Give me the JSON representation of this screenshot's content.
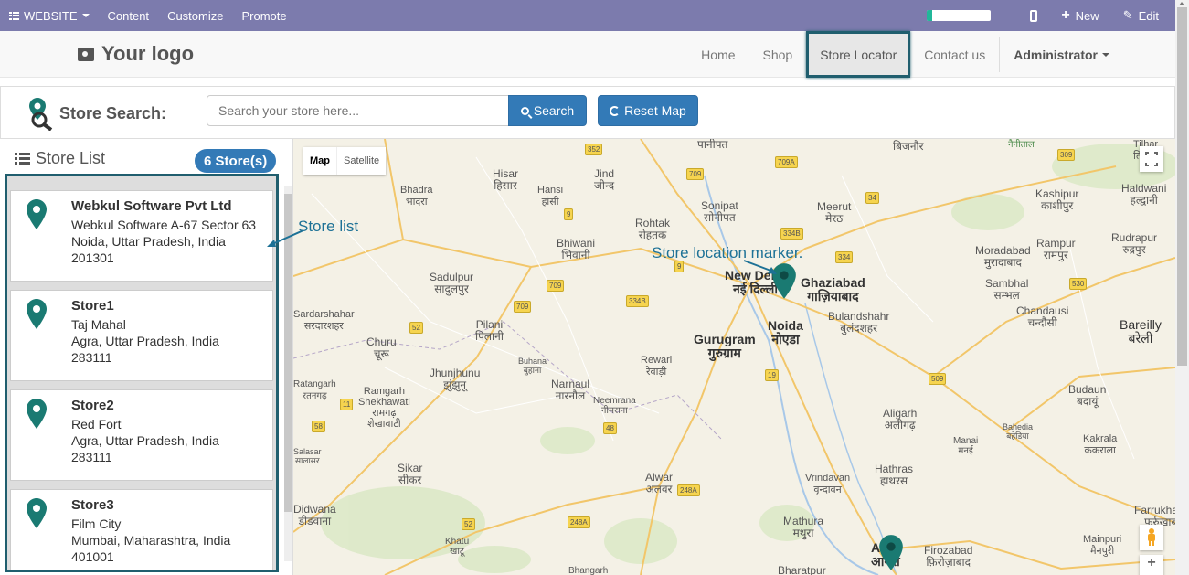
{
  "adminbar": {
    "website_label": "WEBSITE",
    "menu": [
      "Content",
      "Customize",
      "Promote"
    ],
    "progress_fraction": 0.08,
    "new_label": "New",
    "edit_label": "Edit"
  },
  "header": {
    "logo_text": "Your logo",
    "nav": [
      "Home",
      "Shop",
      "Store Locator",
      "Contact us"
    ],
    "active_nav": "Store Locator",
    "user_label": "Administrator"
  },
  "search": {
    "label": "Store Search:",
    "placeholder": "Search your store here...",
    "search_button": "Search",
    "reset_button": "Reset Map"
  },
  "store_list": {
    "title": "Store List",
    "count_badge": "6 Store(s)",
    "stores": [
      {
        "name": "Webkul Software Pvt Ltd",
        "line1": "Webkul Software A-67 Sector 63",
        "line2": "Noida, Uttar Pradesh, India",
        "line3": "201301"
      },
      {
        "name": "Store1",
        "line1": "Taj Mahal",
        "line2": "Agra, Uttar Pradesh, India",
        "line3": "283111"
      },
      {
        "name": "Store2",
        "line1": "Red Fort",
        "line2": "Agra, Uttar Pradesh, India",
        "line3": "283111"
      },
      {
        "name": "Store3",
        "line1": "Film City",
        "line2": "Mumbai, Maharashtra, India",
        "line3": "401001"
      }
    ]
  },
  "map": {
    "map_type": [
      "Map",
      "Satellite"
    ],
    "labels": [
      {
        "id": "panipat",
        "text": "पानीपत"
      },
      {
        "id": "bijnor",
        "text": "बिजनौर"
      },
      {
        "id": "hisar",
        "text": "Hisar\nहिसार"
      },
      {
        "id": "jind",
        "text": "Jind\nजीन्द"
      },
      {
        "id": "bhadra",
        "text": "Bhadra\nभादरा"
      },
      {
        "id": "hansi",
        "text": "Hansi\nहांसी"
      },
      {
        "id": "sonipat",
        "text": "Sonipat\nसोनीपत"
      },
      {
        "id": "meerut",
        "text": "Meerut\nमेरठ"
      },
      {
        "id": "kashipur",
        "text": "Kashipur\nकाशीपुर"
      },
      {
        "id": "haldwani",
        "text": "Haldwani\nहल्द्वानी"
      },
      {
        "id": "rohtak",
        "text": "Rohtak\nरोहतक"
      },
      {
        "id": "bhiwani",
        "text": "Bhiwani\nभिवानी"
      },
      {
        "id": "moradabad",
        "text": "Moradabad\nमुरादाबाद"
      },
      {
        "id": "rampur",
        "text": "Rampur\nरामपुर"
      },
      {
        "id": "rudrapur",
        "text": "Rudrapur\nरुद्रपुर"
      },
      {
        "id": "sadulpur",
        "text": "Sadulpur\nसादुलपुर"
      },
      {
        "id": "newdelhi",
        "text": "New Delhi\nनई दिल्ली"
      },
      {
        "id": "ghaziabad",
        "text": "Ghaziabad\nगाज़ियाबाद"
      },
      {
        "id": "noida",
        "text": "Noida\nनोएडा"
      },
      {
        "id": "sambhal",
        "text": "Sambhal\nसम्भल"
      },
      {
        "id": "chandausi",
        "text": "Chandausi\nचन्दौसी"
      },
      {
        "id": "bulandshahr",
        "text": "Bulandshahr\nबुलंदशहर"
      },
      {
        "id": "bareilly",
        "text": "Bareilly\nबरेली"
      },
      {
        "id": "sardarshahar",
        "text": "Sardarshahar\nसरदारशहर"
      },
      {
        "id": "pilani",
        "text": "Pilani\nपिलानी"
      },
      {
        "id": "gurugram",
        "text": "Gurugram\nगुरुग्राम"
      },
      {
        "id": "churu",
        "text": "Churu\nचूरू"
      },
      {
        "id": "buhana",
        "text": "Buhana\nबुहाना"
      },
      {
        "id": "rewari",
        "text": "Rewari\nरेवाड़ी"
      },
      {
        "id": "jhunjhunu",
        "text": "Jhunjhunu\nझुंझुनू"
      },
      {
        "id": "narnaul",
        "text": "Narnaul\nनारनौल"
      },
      {
        "id": "budaun",
        "text": "Budaun\nबदायूं"
      },
      {
        "id": "ratangarh",
        "text": "Ratangarh\nरतनगढ़"
      },
      {
        "id": "shekhawati",
        "text": "Ramgarh\nShekhawati\nरामगढ़\nशेखावाटी"
      },
      {
        "id": "neemrana",
        "text": "Neemrana\nनीमराना"
      },
      {
        "id": "aligarh",
        "text": "Aligarh\nअलीगढ़"
      },
      {
        "id": "bahedia",
        "text": "Bahedia\nबहेडिया"
      },
      {
        "id": "manai",
        "text": "Manai\nमनई"
      },
      {
        "id": "kakrala",
        "text": "Kakrala\nककराला"
      },
      {
        "id": "salasar",
        "text": "Salasar\nसालासर"
      },
      {
        "id": "sikar",
        "text": "Sikar\nसीकर"
      },
      {
        "id": "hathras",
        "text": "Hathras\nहाथरस"
      },
      {
        "id": "alwar",
        "text": "Alwar\nअलवर"
      },
      {
        "id": "vrindavan",
        "text": "Vrindavan\nवृन्दावन"
      },
      {
        "id": "didwana",
        "text": "Didwana\nडीडवाना"
      },
      {
        "id": "khatu",
        "text": "Khatu\nखाटू"
      },
      {
        "id": "mathura",
        "text": "Mathura\nमथुरा"
      },
      {
        "id": "agra",
        "text": "Agra\nआगरा"
      },
      {
        "id": "firozabad",
        "text": "Firozabad\nफ़िरोज़ाबाद"
      },
      {
        "id": "farrukhabad",
        "text": "Farrukhabad\nफ़र्रुख़ाबाद"
      },
      {
        "id": "mainpuri",
        "text": "Mainpuri\nमैनपुरी"
      },
      {
        "id": "bhangarh",
        "text": "Bhangarh"
      },
      {
        "id": "bharatpur",
        "text": "Bharatpur"
      },
      {
        "id": "nainital",
        "text": "नैनीताल"
      },
      {
        "id": "tilhar",
        "text": "Tilhar\nतिलहर"
      }
    ],
    "highways": [
      "352",
      "709",
      "709A",
      "34",
      "309",
      "9",
      "334B",
      "334",
      "9",
      "530",
      "52",
      "709",
      "334B",
      "709",
      "19",
      "509",
      "52",
      "11",
      "58",
      "48",
      "248A",
      "52",
      "248A",
      "9",
      "709"
    ]
  },
  "annotations": {
    "store_list": "Store list",
    "store_marker": "Store location marker."
  },
  "colors": {
    "admin_bar": "#7c7bad",
    "primary": "#337ab7",
    "highlight_border": "#205e6e",
    "marker": "#1a7a72",
    "annotation": "#1d7196"
  }
}
